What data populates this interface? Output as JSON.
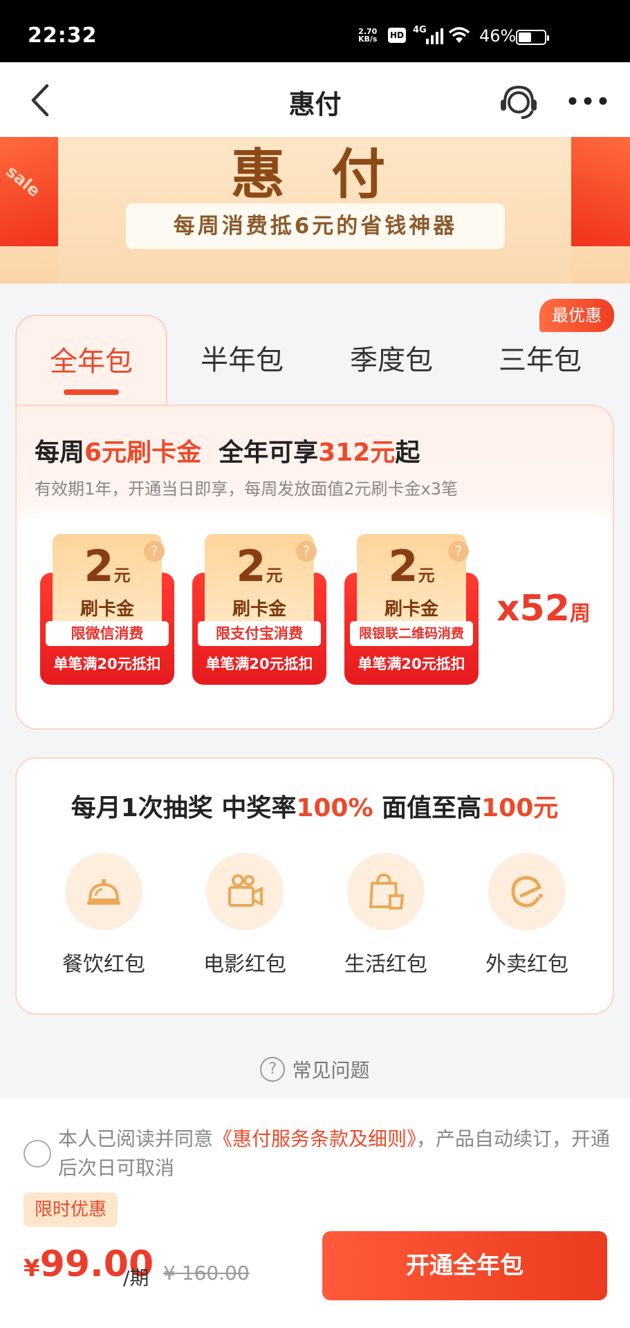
{
  "status_bar": {
    "time": "22:32",
    "net_speed_value": "2.70",
    "net_speed_unit": "KB/s",
    "hd": "HD",
    "signal": "4G",
    "battery": "46%"
  },
  "header": {
    "title": "惠付",
    "back_icon": "chevron-left-icon",
    "service_icon": "customer-service-icon",
    "more_icon": "more-icon"
  },
  "banner": {
    "title": "惠 付",
    "slogan": "每周消费抵6元的省钱神器",
    "deco_text": "sale"
  },
  "tabs": {
    "items": [
      {
        "label": "全年包",
        "active": true
      },
      {
        "label": "半年包",
        "active": false
      },
      {
        "label": "季度包",
        "active": false
      },
      {
        "label": "三年包",
        "active": false
      }
    ],
    "best_badge": "最优惠"
  },
  "package": {
    "headline_a": "每周",
    "headline_b": "6元刷卡金",
    "headline_c": "全年可享",
    "headline_d": "312元",
    "headline_e": "起",
    "desc": "有效期1年，开通当日即享，每周发放面值2元刷卡金x3笔",
    "coupons": [
      {
        "amount": "2",
        "unit": "元",
        "name": "刷卡金",
        "limit": "限微信消费",
        "rule": "单笔满20元抵扣",
        "help": "?"
      },
      {
        "amount": "2",
        "unit": "元",
        "name": "刷卡金",
        "limit": "限支付宝消费",
        "rule": "单笔满20元抵扣",
        "help": "?"
      },
      {
        "amount": "2",
        "unit": "元",
        "name": "刷卡金",
        "limit": "限银联二维码消费",
        "rule": "单笔满20元抵扣",
        "help": "?"
      }
    ],
    "weeks_prefix": "x52",
    "weeks_suffix": "周"
  },
  "lottery": {
    "h_a": "每月1次抽奖 中奖率",
    "h_b": "100%",
    "h_c": " 面值至高",
    "h_d": "100元",
    "items": [
      {
        "label": "餐饮红包",
        "icon": "dining-icon"
      },
      {
        "label": "电影红包",
        "icon": "movie-camera-icon"
      },
      {
        "label": "生活红包",
        "icon": "shopping-bag-icon"
      },
      {
        "label": "外卖红包",
        "icon": "takeout-icon"
      }
    ]
  },
  "faq": {
    "icon_text": "?",
    "label": "常见问题"
  },
  "bottom": {
    "agree_a": "本人已阅读并同意",
    "agree_link": "《惠付服务条款及细则》",
    "agree_b": "，产品自动续订，开通后次日可取消",
    "badge": "限时优惠",
    "currency": "¥",
    "price": "99.00",
    "per": "/期",
    "original": "¥ 160.00",
    "cta": "开通全年包"
  },
  "colors": {
    "accent": "#ec4a2a",
    "coupon_red": "#e61a1e",
    "coupon_gold": "#ffd49b"
  }
}
